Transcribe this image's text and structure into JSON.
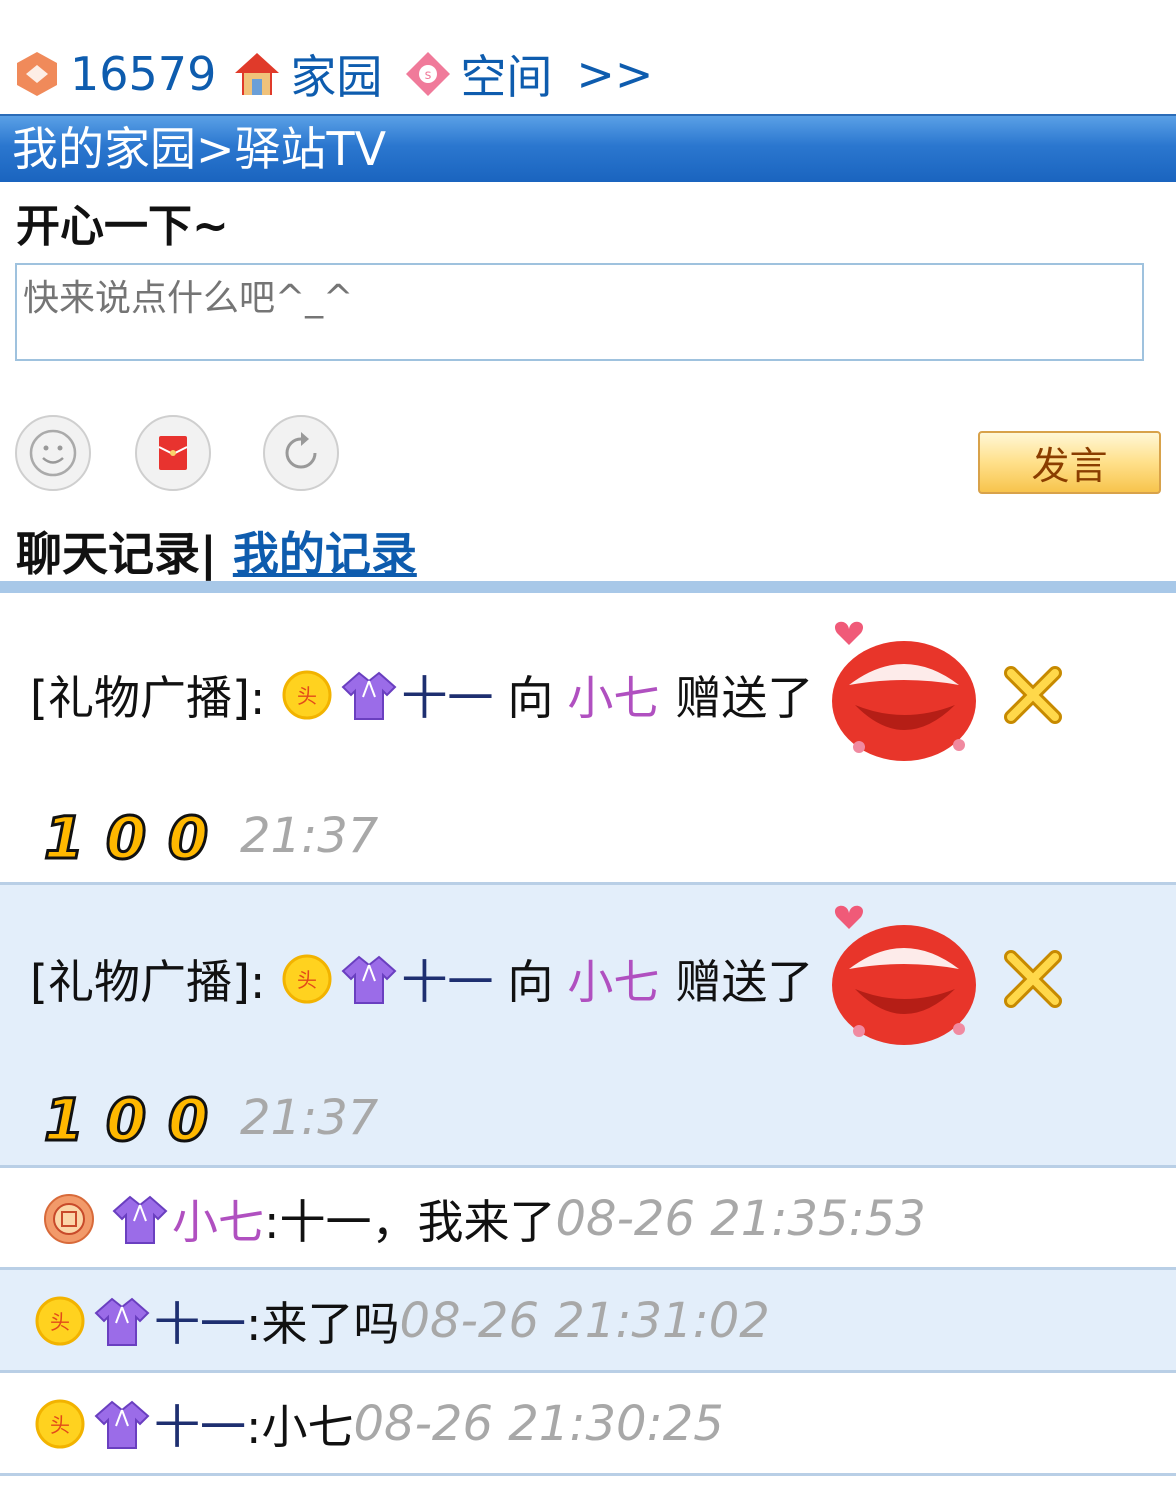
{
  "topnav": {
    "count": "16579",
    "home_label": "家园",
    "space_label": "空间",
    "more_label": ">>"
  },
  "titlebar": {
    "text": "我的家园>驿站TV"
  },
  "section_title": "开心一下~",
  "message_box": {
    "placeholder": "快来说点什么吧^_^"
  },
  "toolbar": {
    "send_label": "发言"
  },
  "tabs": {
    "chat_log": "聊天记录|",
    "my_log": "我的记录"
  },
  "gift_rows": [
    {
      "prefix": "[礼物广播]:",
      "sender": "十一",
      "verb": "向",
      "receiver": "小七",
      "action": "赠送了",
      "digits": [
        "1",
        "0",
        "0"
      ],
      "time": "21:37"
    },
    {
      "prefix": "[礼物广播]:",
      "sender": "十一",
      "verb": "向",
      "receiver": "小七",
      "action": "赠送了",
      "digits": [
        "1",
        "0",
        "0"
      ],
      "time": "21:37"
    }
  ],
  "chat_rows": [
    {
      "name": "小七",
      "message": ":十一，我来了",
      "time": "08-26 21:35:53"
    },
    {
      "name": "十一",
      "message": ":来了吗",
      "time": "08-26 21:31:02"
    },
    {
      "name": "十一",
      "message": ":小七",
      "time": "08-26 21:30:25"
    }
  ],
  "colors": {
    "link_blue": "#0e5cae",
    "title_bar_blue": "#2b77cf",
    "name_purple": "#b050c0",
    "name_dark": "#1e2f70",
    "time_gray": "#a8a8a8",
    "row_alt_bg": "#e3eefa"
  },
  "icons": {
    "topnav": [
      "hex-badge-icon",
      "house-icon",
      "diamond-icon"
    ],
    "toolbar": [
      "smiley-icon",
      "red-envelope-icon",
      "refresh-icon"
    ],
    "gift": [
      "coin-badge-icon",
      "purple-robe-icon",
      "lips-gift-icon",
      "times-icon",
      "digit-icon"
    ],
    "chat": [
      "medal-icon",
      "coin-badge-icon",
      "purple-robe-icon"
    ]
  }
}
